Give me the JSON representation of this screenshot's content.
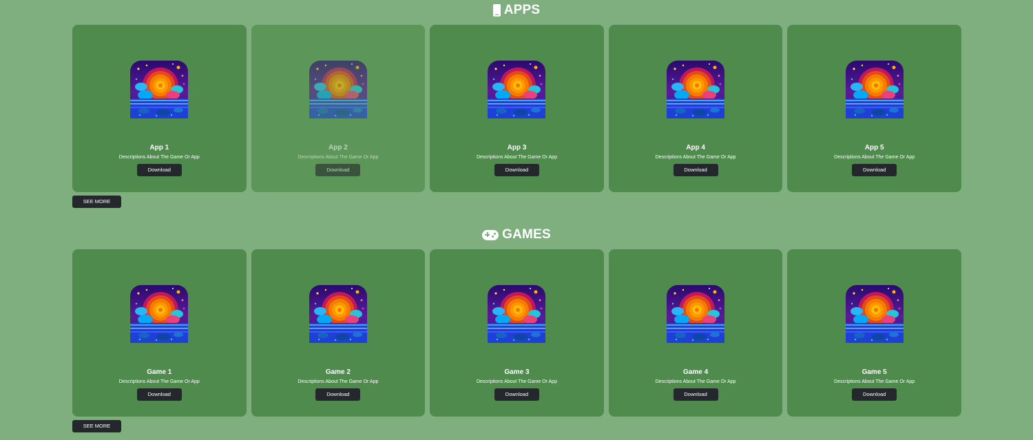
{
  "apps": {
    "title": "APPS",
    "icon": "phone-icon",
    "see_more": "SEE MORE",
    "items": [
      {
        "title": "App 1",
        "desc": "Descriptions About The Game Or App",
        "button": "Download"
      },
      {
        "title": "App 2",
        "desc": "Descriptions About The Game Or App",
        "button": "Download"
      },
      {
        "title": "App 3",
        "desc": "Descriptions About The Game Or App",
        "button": "Download"
      },
      {
        "title": "App 4",
        "desc": "Descriptions About The Game Or App",
        "button": "Download"
      },
      {
        "title": "App 5",
        "desc": "Descriptions About The Game Or App",
        "button": "Download"
      }
    ]
  },
  "games": {
    "title": "GAMES",
    "icon": "gamepad-icon",
    "see_more": "SEE MORE",
    "items": [
      {
        "title": "Game 1",
        "desc": "Descriptions About The Game Or App",
        "button": "Download"
      },
      {
        "title": "Game 2",
        "desc": "Descriptions About The Game Or App",
        "button": "Download"
      },
      {
        "title": "Game 3",
        "desc": "Descriptions About The Game Or App",
        "button": "Download"
      },
      {
        "title": "Game 4",
        "desc": "Descriptions About The Game Or App",
        "button": "Download"
      },
      {
        "title": "Game 5",
        "desc": "Descriptions About The Game Or App",
        "button": "Download"
      }
    ]
  },
  "colors": {
    "page_bg": "#7fae7f",
    "card_bg": "#4e8b4c",
    "card_hover_bg": "#5c9659",
    "button_bg": "#24272b"
  }
}
